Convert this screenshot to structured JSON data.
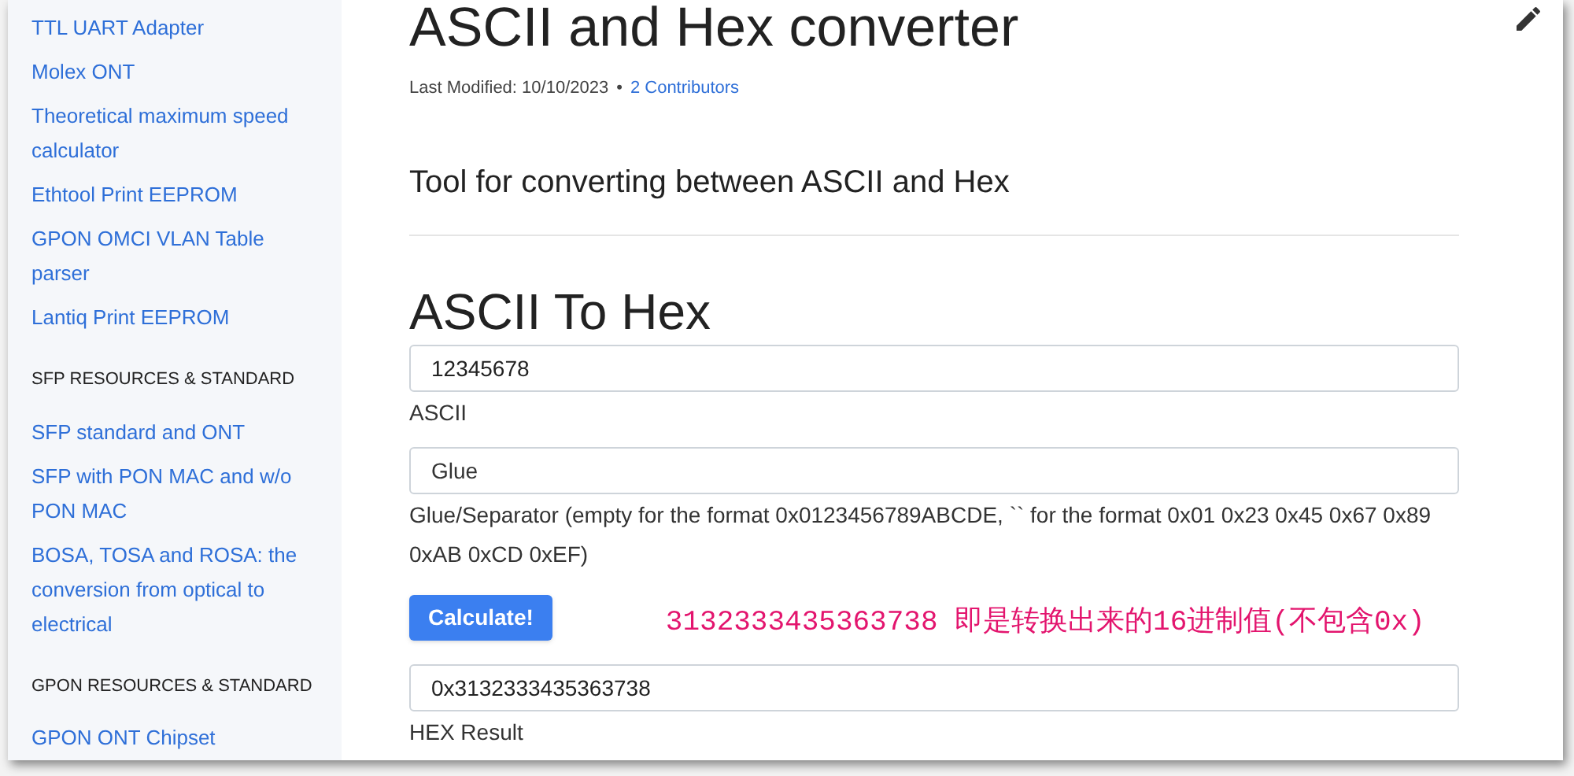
{
  "sidebar": {
    "sections": [
      {
        "items": [
          "TTL UART Adapter",
          "Molex ONT",
          "Theoretical maximum speed calculator",
          "Ethtool Print EEPROM",
          "GPON OMCI VLAN Table parser",
          "Lantiq Print EEPROM"
        ]
      },
      {
        "heading": "SFP RESOURCES & STANDARD",
        "items": [
          "SFP standard and ONT",
          "SFP with PON MAC and w/o PON MAC",
          "BOSA, TOSA and ROSA: the conversion from optical to electrical"
        ]
      },
      {
        "heading": "GPON RESOURCES & STANDARD",
        "items": [
          "GPON ONT Chipset"
        ]
      }
    ]
  },
  "page": {
    "title": "ASCII and Hex converter",
    "last_modified": "Last Modified: 10/10/2023",
    "separator": "•",
    "contributors": "2 Contributors",
    "lead": "Tool for converting between ASCII and Hex",
    "section_title": "ASCII To Hex",
    "ascii_field": {
      "value": "12345678",
      "label": "ASCII"
    },
    "glue_field": {
      "placeholder": "Glue",
      "label": "Glue/Separator (empty for the format 0x0123456789ABCDE, `` for the format 0x01 0x23 0x45 0x67 0x89 0xAB 0xCD 0xEF)"
    },
    "button": "Calculate!",
    "annotation": "3132333435363738 即是转换出来的16进制值(不包含0x)",
    "result_field": {
      "value": "0x3132333435363738",
      "label": "HEX Result"
    }
  }
}
